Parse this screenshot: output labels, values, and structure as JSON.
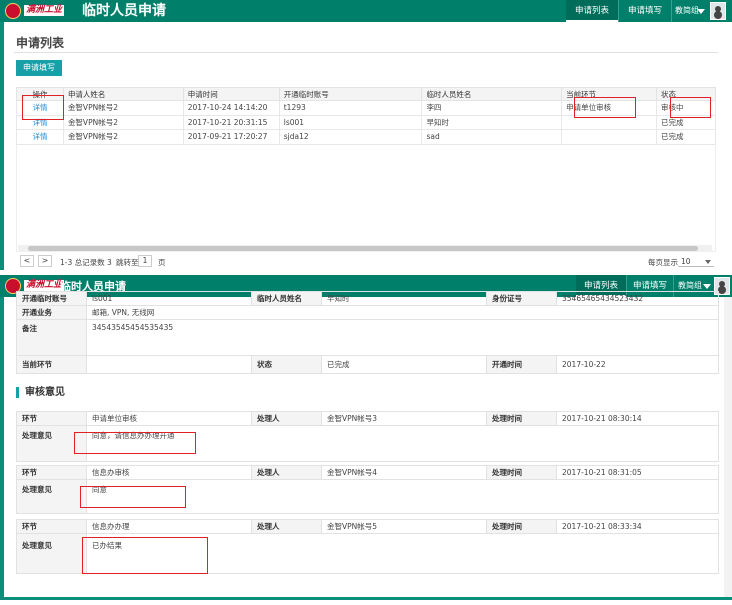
{
  "app": {
    "logo_text": "满洲工业",
    "title": "临时人员申请"
  },
  "nav": {
    "tab_list": "申请列表",
    "tab_form": "申请填写",
    "user": "教简组"
  },
  "list_page": {
    "title": "申请列表",
    "new_button": "申请填写",
    "columns": [
      "操作",
      "申请人姓名",
      "申请时间",
      "开通临时账号",
      "临时人员姓名",
      "当前环节",
      "状态"
    ],
    "rows": [
      {
        "action": "详情",
        "applicant": "金智VPN帐号2",
        "time": "2017-10-24 14:14:20",
        "account": "t1293",
        "temp_name": "李四",
        "stage": "申请单位审核",
        "status": "审核中"
      },
      {
        "action": "详情",
        "applicant": "金智VPN帐号2",
        "time": "2017-10-21 20:31:15",
        "account": "ls001",
        "temp_name": "早知时",
        "stage": "",
        "status": "已完成"
      },
      {
        "action": "详情",
        "applicant": "金智VPN帐号2",
        "time": "2017-09-21 17:20:27",
        "account": "sjda12",
        "temp_name": "sad",
        "stage": "",
        "status": "已完成"
      }
    ],
    "pager": {
      "prev": "<",
      "next": ">",
      "summary": "1-3 总记录数 3",
      "jump_label": "跳转至",
      "page": "1",
      "page_unit": "页",
      "per_page_label": "每页显示",
      "per_page": "10"
    }
  },
  "detail_page": {
    "info": {
      "account_label": "开通临时账号",
      "account": "ls001",
      "name_label": "临时人员姓名",
      "name": "早知时",
      "id_label": "身份证号",
      "id": "35465465434523432",
      "services_label": "开通业务",
      "services": "邮箱, VPN, 无线网",
      "remark_label": "备注",
      "remark": "34543545454535435",
      "stage_label": "当前环节",
      "stage": "",
      "status_label": "状态",
      "status": "已完成",
      "open_time_label": "开通时间",
      "open_time": "2017-10-22"
    },
    "review_title": "审核意见",
    "reviews": [
      {
        "step_label": "环节",
        "step": "申请单位审核",
        "handler_label": "处理人",
        "handler": "金智VPN帐号3",
        "time_label": "处理时间",
        "time": "2017-10-21 08:30:14",
        "opinion_label": "处理意见",
        "opinion": "同意，请信息办办理开通"
      },
      {
        "step_label": "环节",
        "step": "信息办审核",
        "handler_label": "处理人",
        "handler": "金智VPN帐号4",
        "time_label": "处理时间",
        "time": "2017-10-21 08:31:05",
        "opinion_label": "处理意见",
        "opinion": "同意"
      },
      {
        "step_label": "环节",
        "step": "信息办办理",
        "handler_label": "处理人",
        "handler": "金智VPN帐号5",
        "time_label": "处理时间",
        "time": "2017-10-21 08:33:34",
        "opinion_label": "处理意见",
        "opinion": "已办结果"
      }
    ]
  },
  "colors": {
    "brand": "#00806b",
    "accent": "#17a0a8",
    "link": "#1f8bd1",
    "highlight": "#e0202a"
  }
}
